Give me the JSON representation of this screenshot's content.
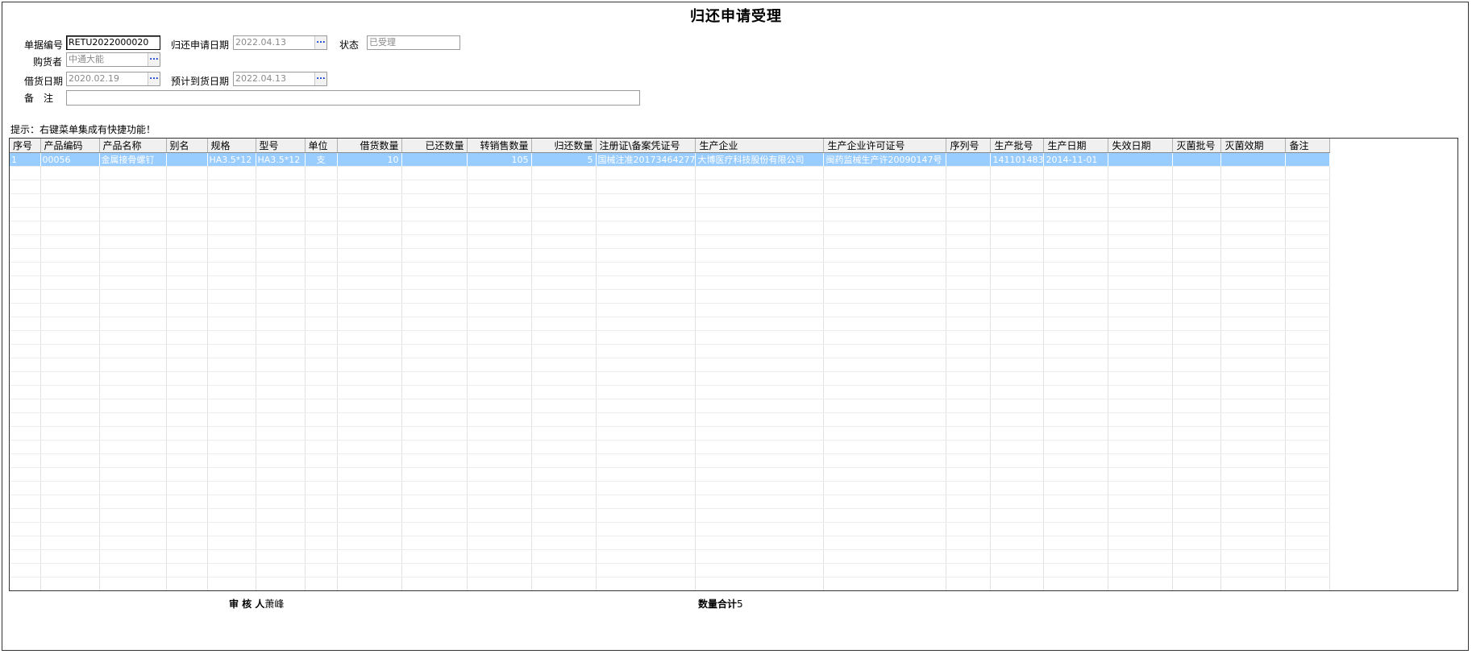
{
  "title": "归还申请受理",
  "form": {
    "doc_no_label": "单据编号",
    "doc_no": "RETU2022000020",
    "return_date_label": "归还申请日期",
    "return_date": "2022.04.13",
    "status_label": "状态",
    "status": "已受理",
    "buyer_label": "购货者",
    "buyer": "中通大能",
    "borrow_date_label": "借货日期",
    "borrow_date": "2020.02.19",
    "arrival_date_label": "预计到货日期",
    "arrival_date": "2022.04.13",
    "remark_label": "备　注",
    "remark": "",
    "picker_label": "..."
  },
  "hint": "提示：右键菜单集成有快捷功能！",
  "table": {
    "headers": [
      "序号",
      "产品编码",
      "产品名称",
      "别名",
      "规格",
      "型号",
      "单位",
      "借货数量",
      "已还数量",
      "转销售数量",
      "归还数量",
      "注册证\\备案凭证号",
      "生产企业",
      "生产企业许可证号",
      "序列号",
      "生产批号",
      "生产日期",
      "失效日期",
      "灭菌批号",
      "灭菌效期",
      "备注"
    ],
    "rows": [
      [
        "1",
        "00056",
        "金属接骨螺钉",
        "",
        "HA3.5*12",
        "HA3.5*12",
        "支",
        "10",
        "",
        "105",
        "5",
        "国械注准20173464277",
        "大博医疗科技股份有限公司",
        "闽药监械生产许20090147号",
        "",
        "141101483",
        "2014-11-01",
        "",
        "",
        "",
        ""
      ]
    ]
  },
  "footer": {
    "auditor_label": "审 核 人",
    "auditor": "萧峰",
    "total_label": "数量合计",
    "total": "5"
  }
}
